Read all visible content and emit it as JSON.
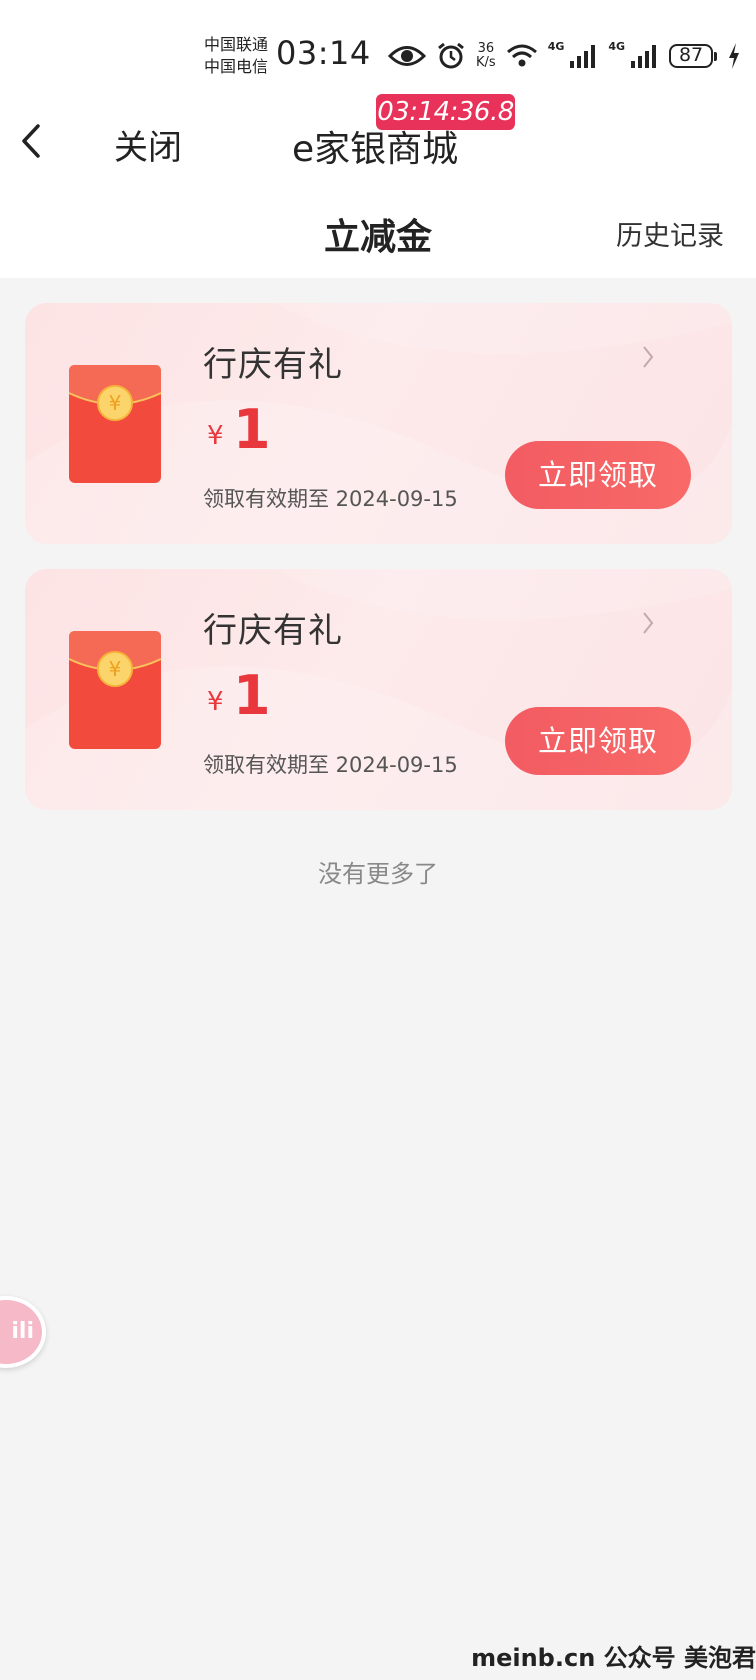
{
  "status_bar": {
    "carrier_1": "中国联通",
    "carrier_2": "中国电信",
    "time": "03:14",
    "net_speed_value": "36",
    "net_speed_unit": "K/s",
    "net_type_1": "4G",
    "net_type_2": "4G",
    "battery": "87",
    "icons": [
      "eye-icon",
      "alarm-icon",
      "wifi-icon",
      "signal-icon",
      "signal-icon",
      "battery-icon",
      "charging-icon"
    ]
  },
  "timer_overlay": "03:14:36.8",
  "nav": {
    "back_icon": "chevron-left-icon",
    "close_label": "关闭",
    "title": "e家银商城"
  },
  "header": {
    "title": "立减金",
    "history_label": "历史记录"
  },
  "coupons": [
    {
      "title": "行庆有礼",
      "currency": "¥",
      "amount": "1",
      "validity": "领取有效期至 2024-09-15",
      "button_label": "立即领取"
    },
    {
      "title": "行庆有礼",
      "currency": "¥",
      "amount": "1",
      "validity": "领取有效期至 2024-09-15",
      "button_label": "立即领取"
    }
  ],
  "empty_hint": "没有更多了",
  "float_ball_label": "ili",
  "watermark": "meinb.cn 公众号 美泡君",
  "colors": {
    "accent": "#e8383d",
    "button": "#f25b62",
    "card_bg": "#fde3e4",
    "page_bg": "#f4f4f4",
    "timer_badge": "#e8325a"
  }
}
